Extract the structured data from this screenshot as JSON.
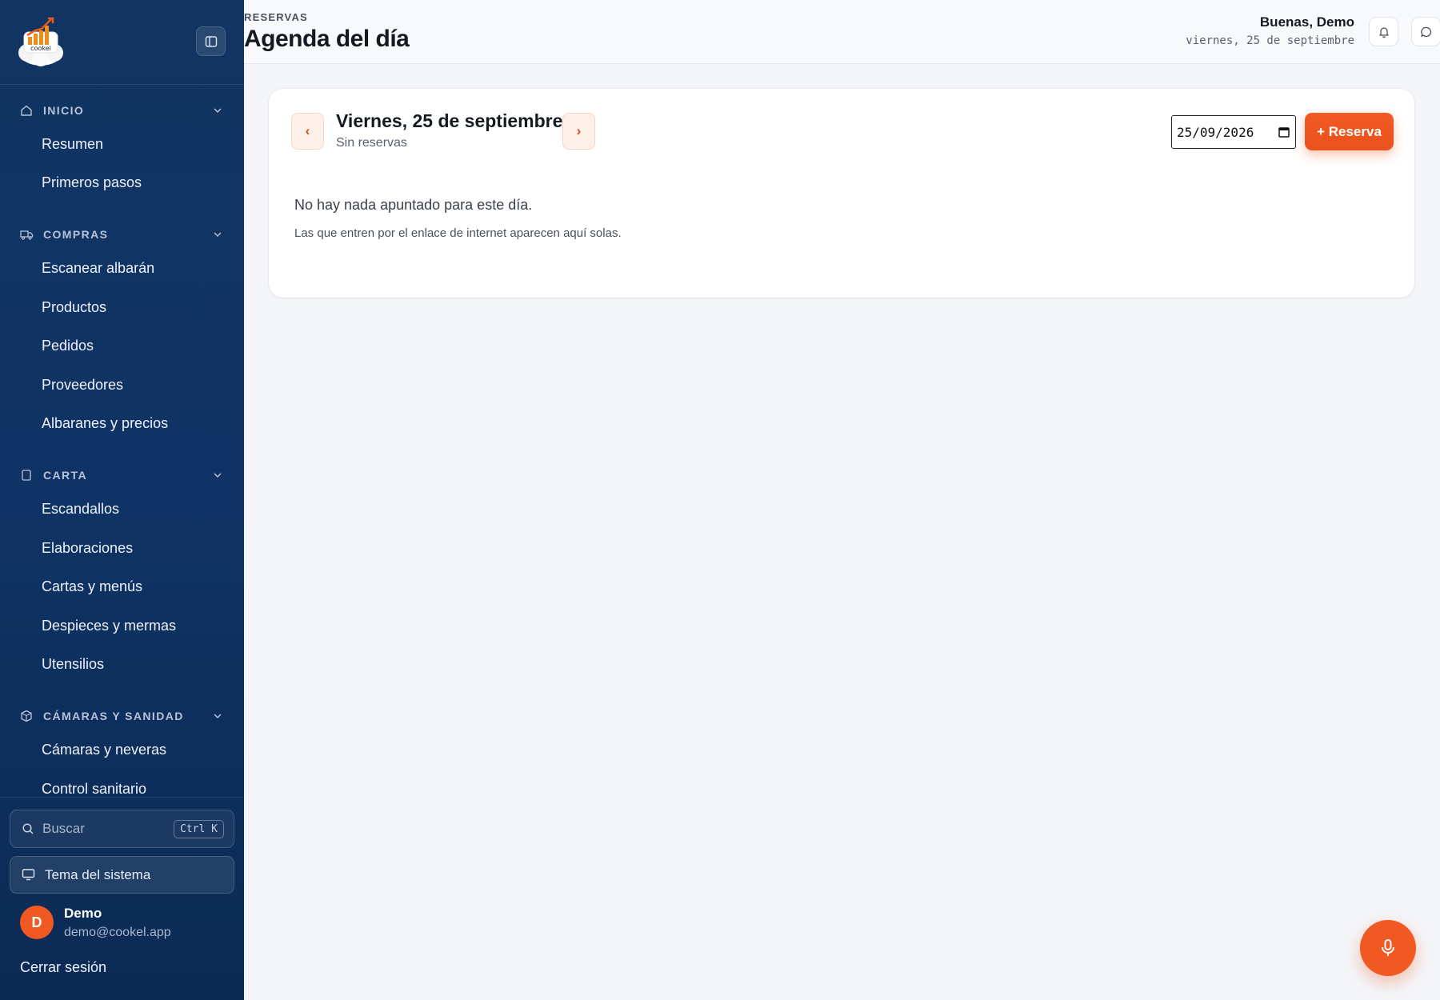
{
  "brand": {
    "logo_text": "cookel",
    "accent": "#f05a22",
    "sidebar_bg": "#113462"
  },
  "sidebar": {
    "sections": [
      {
        "label": "INICIO",
        "icon": "home-icon",
        "items": [
          "Resumen",
          "Primeros pasos"
        ]
      },
      {
        "label": "COMPRAS",
        "icon": "truck-icon",
        "items": [
          "Escanear albarán",
          "Productos",
          "Pedidos",
          "Proveedores",
          "Albaranes y precios"
        ]
      },
      {
        "label": "CARTA",
        "icon": "book-icon",
        "items": [
          "Escandallos",
          "Elaboraciones",
          "Cartas y menús",
          "Despieces y mermas",
          "Utensilios"
        ]
      },
      {
        "label": "CÁMARAS Y SANIDAD",
        "icon": "box-icon",
        "items": [
          "Cámaras y neveras",
          "Control sanitario"
        ]
      }
    ],
    "search": {
      "placeholder": "Buscar",
      "shortcut": "Ctrl K"
    },
    "theme_label": "Tema del sistema",
    "user": {
      "initial": "D",
      "name": "Demo",
      "email": "demo@cookel.app"
    },
    "logout_label": "Cerrar sesión"
  },
  "header": {
    "eyebrow": "RESERVAS",
    "title": "Agenda del día",
    "greeting": "Buenas, Demo",
    "date": "viernes, 25 de septiembre"
  },
  "agenda": {
    "prev_label": "‹",
    "next_label": "›",
    "day_title": "Viernes, 25 de septiembre",
    "day_subtitle": "Sin reservas",
    "date_value": "25/09/2026",
    "new_button": "+ Reserva",
    "empty_title": "No hay nada apuntado para este día.",
    "empty_hint": "Las que entren por el enlace de internet aparecen aquí solas."
  }
}
